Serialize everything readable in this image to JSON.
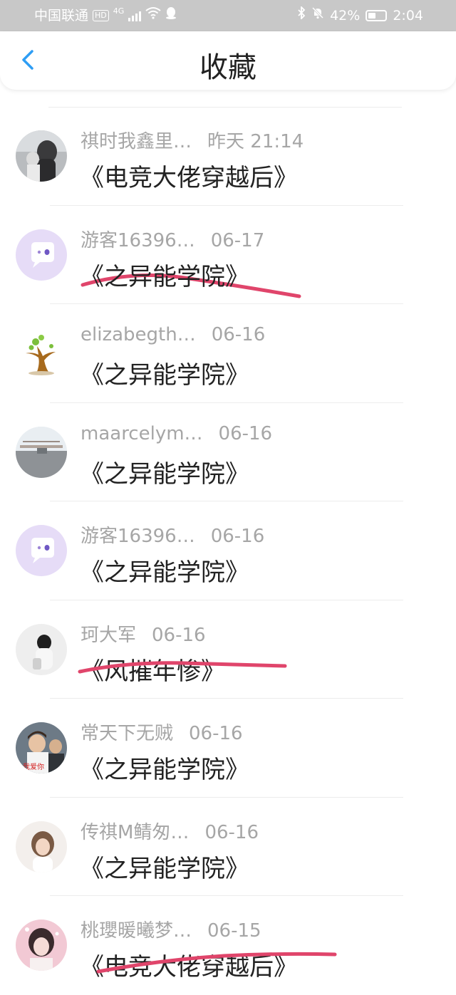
{
  "status_bar": {
    "carrier": "中国联通",
    "hd": "HD",
    "network": "4G",
    "battery": "42%",
    "time": "2:04"
  },
  "header": {
    "back_icon": "chevron-left-icon",
    "title": "收藏"
  },
  "colors": {
    "accent": "#2e9df4",
    "strike": "#e0456b",
    "meta_text": "#a6a6a6",
    "title_text": "#222222"
  },
  "items": [
    {
      "user": "祺时我鑫里…",
      "time": "昨天 21:14",
      "book": "《电竞大佬穿越后》",
      "struck": true
    },
    {
      "user": "游客16396…",
      "time": "06-17",
      "book": "《之异能学院》",
      "struck": false
    },
    {
      "user": "elizabegth…",
      "time": "06-16",
      "book": "《之异能学院》",
      "struck": false
    },
    {
      "user": "maarcelym…",
      "time": "06-16",
      "book": "《之异能学院》",
      "struck": false
    },
    {
      "user": "游客16396…",
      "time": "06-16",
      "book": "《之异能学院》",
      "struck": false
    },
    {
      "user": "珂大军",
      "time": "06-16",
      "book": "《风摧年惨》",
      "struck": true
    },
    {
      "user": "常天下无贼",
      "time": "06-16",
      "book": "《之异能学院》",
      "struck": false
    },
    {
      "user": "传祺M鲭匆…",
      "time": "06-16",
      "book": "《之异能学院》",
      "struck": false
    },
    {
      "user": "桃瓔暖曦梦…",
      "time": "06-15",
      "book": "《电竞大佬穿越后》",
      "struck": true
    }
  ]
}
